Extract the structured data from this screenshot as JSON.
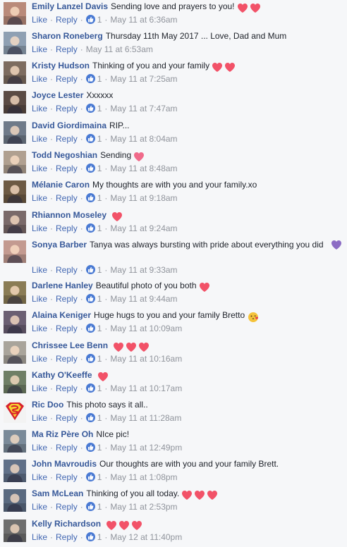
{
  "comments": [
    {
      "author": "Emily Lanzel Davis",
      "text": "Sending love and prayers to you!",
      "emoji": [
        "heart",
        "heart"
      ],
      "like_label": "Like",
      "reply_label": "Reply",
      "reactions": "1",
      "time": "May 11 at 6:36am"
    },
    {
      "author": "Sharon Roneberg",
      "text": "Thursday 11th May 2017 ... Love, Dad and Mum",
      "emoji": [],
      "like_label": "Like",
      "reply_label": "Reply",
      "reactions": "",
      "time": "May 11 at 6:53am"
    },
    {
      "author": "Kristy Hudson",
      "text": "Thinking of you and your family",
      "emoji": [
        "heart",
        "heart"
      ],
      "like_label": "Like",
      "reply_label": "Reply",
      "reactions": "1",
      "time": "May 11 at 7:25am"
    },
    {
      "author": "Joyce Lester",
      "text": "Xxxxxx",
      "emoji": [],
      "like_label": "Like",
      "reply_label": "Reply",
      "reactions": "1",
      "time": "May 11 at 7:47am"
    },
    {
      "author": "David Giordimaina",
      "text": "RIP...",
      "emoji": [],
      "like_label": "Like",
      "reply_label": "Reply",
      "reactions": "1",
      "time": "May 11 at 8:04am"
    },
    {
      "author": "Todd Negoshian",
      "text": "Sending",
      "emoji": [
        "heart-small"
      ],
      "like_label": "Like",
      "reply_label": "Reply",
      "reactions": "1",
      "time": "May 11 at 8:48am"
    },
    {
      "author": "Mélanie Caron",
      "text": "My thoughts are with you and your family.xo",
      "emoji": [],
      "like_label": "Like",
      "reply_label": "Reply",
      "reactions": "1",
      "time": "May 11 at 9:18am"
    },
    {
      "author": "Rhiannon Moseley",
      "text": "",
      "emoji": [
        "heart"
      ],
      "like_label": "Like",
      "reply_label": "Reply",
      "reactions": "1",
      "time": "May 11 at 9:24am"
    },
    {
      "author": "Sonya Barber",
      "text": "Tanya was always bursting with pride about everything you did",
      "emoji": [
        "purple-heart"
      ],
      "like_label": "Like",
      "reply_label": "Reply",
      "reactions": "1",
      "time": "May 11 at 9:33am"
    },
    {
      "author": "Darlene Hanley",
      "text": "Beautiful photo of you both",
      "emoji": [
        "heart"
      ],
      "like_label": "Like",
      "reply_label": "Reply",
      "reactions": "1",
      "time": "May 11 at 9:44am"
    },
    {
      "author": "Alaina Keniger",
      "text": "Huge hugs to you and your family Bretto",
      "emoji": [
        "kiss-face"
      ],
      "like_label": "Like",
      "reply_label": "Reply",
      "reactions": "1",
      "time": "May 11 at 10:09am"
    },
    {
      "author": "Chrissee Lee Benn",
      "text": "",
      "emoji": [
        "heart",
        "heart",
        "heart"
      ],
      "like_label": "Like",
      "reply_label": "Reply",
      "reactions": "1",
      "time": "May 11 at 10:16am"
    },
    {
      "author": "Kathy O'Keeffe",
      "text": "",
      "emoji": [
        "heart"
      ],
      "like_label": "Like",
      "reply_label": "Reply",
      "reactions": "1",
      "time": "May 11 at 10:17am"
    },
    {
      "author": "Ric Doo",
      "text": "This photo says it all..",
      "emoji": [],
      "like_label": "Like",
      "reply_label": "Reply",
      "reactions": "1",
      "time": "May 11 at 11:28am"
    },
    {
      "author": "Ma Riz Père Oh",
      "text": "NIce pic!",
      "emoji": [],
      "like_label": "Like",
      "reply_label": "Reply",
      "reactions": "1",
      "time": "May 11 at 12:49pm"
    },
    {
      "author": "John Mavroudis",
      "text": "Our thoughts are with you and your family Brett.",
      "emoji": [],
      "like_label": "Like",
      "reply_label": "Reply",
      "reactions": "1",
      "time": "May 11 at 1:08pm"
    },
    {
      "author": "Sam McLean",
      "text": "Thinking of you all today.",
      "emoji": [
        "heart",
        "heart",
        "heart"
      ],
      "like_label": "Like",
      "reply_label": "Reply",
      "reactions": "1",
      "time": "May 11 at 2:53pm"
    },
    {
      "author": "Kelly Richardson",
      "text": "",
      "emoji": [
        "heart",
        "heart",
        "heart"
      ],
      "like_label": "Like",
      "reply_label": "Reply",
      "reactions": "1",
      "time": "May 12 at 11:40pm"
    }
  ],
  "colors": {
    "author": "#365899",
    "link": "#4267b2",
    "meta": "#90949c",
    "heart": "#f25268",
    "like_badge": "#4a7ad3",
    "purple_heart": "#8c6cc4"
  }
}
